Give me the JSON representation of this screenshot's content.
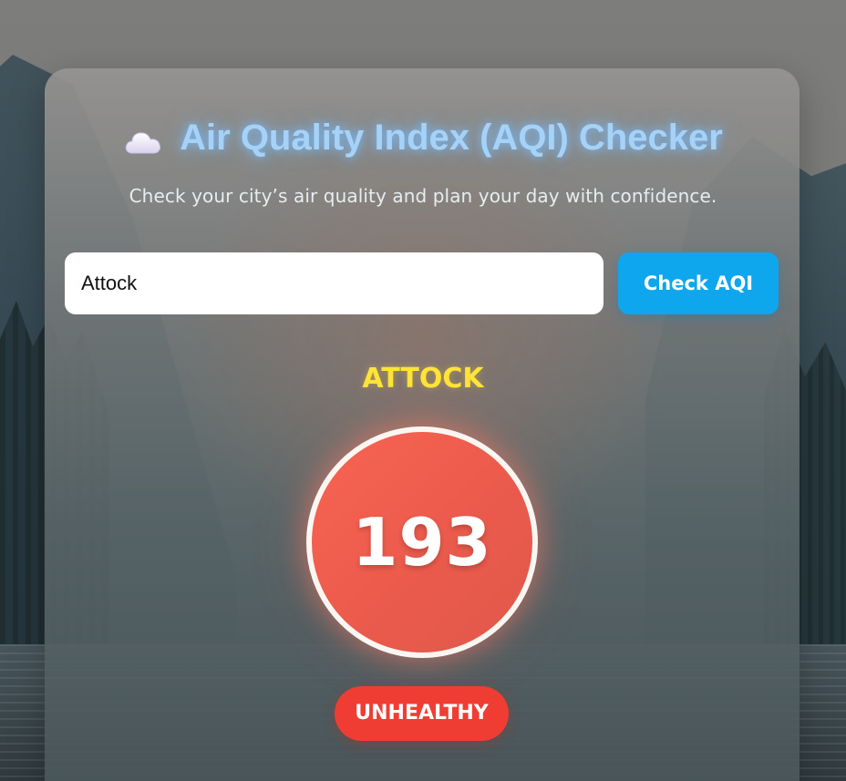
{
  "header": {
    "icon": "cloud-icon",
    "title": "Air Quality Index (AQI) Checker",
    "subtitle": "Check your city’s air quality and plan your day with confidence."
  },
  "search": {
    "value": "Attock",
    "button_label": "Check AQI"
  },
  "result": {
    "city": "ATTOCK",
    "aqi": "193",
    "status": "UNHEALTHY"
  },
  "colors": {
    "title": "#a6d2f8",
    "city": "#ffe436",
    "button": "#0ea7ee",
    "aqi_circle": "#ec5b4c",
    "status_badge": "#f03d33"
  }
}
